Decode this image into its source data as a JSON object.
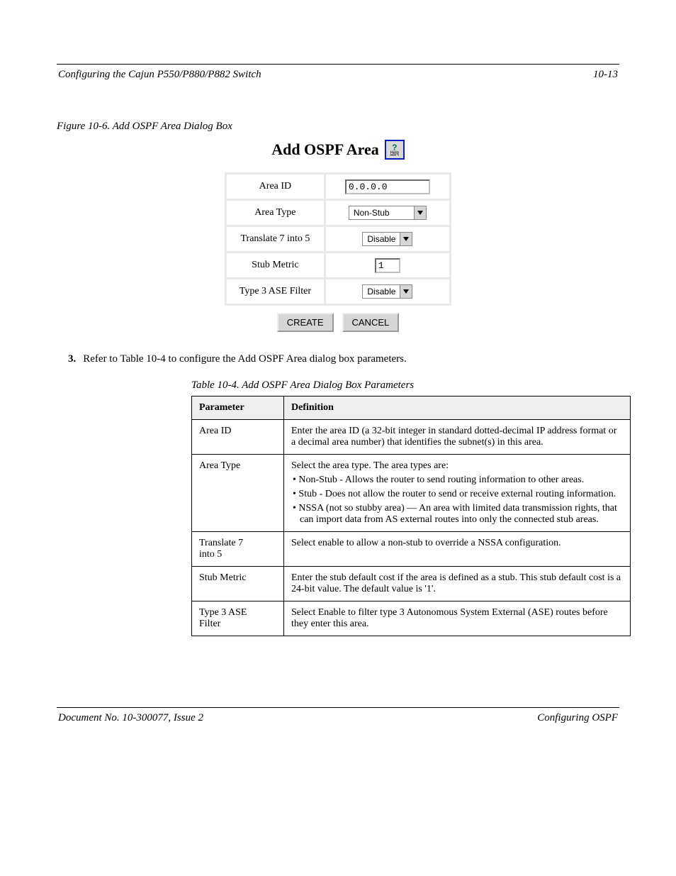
{
  "header": {
    "left": "Configuring the Cajun P550/P880/P882 Switch",
    "right": "10-13"
  },
  "figure": {
    "caption": "Figure 10-6.  Add OSPF Area Dialog Box"
  },
  "dialog": {
    "title": "Add OSPF Area",
    "help_label": "Help",
    "fields": {
      "area_id": {
        "label": "Area ID",
        "value": "0.0.0.0"
      },
      "area_type": {
        "label": "Area Type",
        "value": "Non-Stub"
      },
      "translate": {
        "label": "Translate 7 into 5",
        "value": "Disable"
      },
      "stub_metric": {
        "label": "Stub Metric",
        "value": "1"
      },
      "type3_ase": {
        "label": "Type 3 ASE Filter",
        "value": "Disable"
      }
    },
    "buttons": {
      "create": "CREATE",
      "cancel": "CANCEL"
    }
  },
  "step": {
    "num": "3.",
    "text": "Refer to Table 10-4 to configure the Add OSPF Area dialog box parameters."
  },
  "table": {
    "caption": "Table 10-4.  Add OSPF Area Dialog Box Parameters",
    "headers": {
      "c1": "Parameter",
      "c2": "Definition"
    },
    "rows": [
      {
        "c1": "Area ID",
        "c2": "Enter the area ID (a 32-bit integer in standard dotted-decimal IP address format or a decimal area number) that identifies the subnet(s) in this area."
      },
      {
        "c1": "Area Type",
        "c2": "Select the area type. The area types are:\n• Non-Stub - Allows the router to send routing information to other areas.\n• Stub - Does not allow the router to send or receive external routing information.\n• NSSA (not so stubby area) — An area with limited data transmission rights, that can import data from AS external routes into only the connected stub areas."
      },
      {
        "c1": "Translate 7\ninto 5",
        "c2": "Select enable to allow a non-stub to override a NSSA configuration."
      },
      {
        "c1": "Stub Metric",
        "c2": "Enter the stub default cost if the area is defined as a stub. This stub default cost is a 24-bit value. The default value is '1'."
      },
      {
        "c1": "Type 3 ASE\nFilter",
        "c2": "Select Enable to filter type 3 Autonomous System External (ASE) routes before they enter this area."
      }
    ]
  },
  "footer": {
    "left": "Document No. 10-300077, Issue 2",
    "right": "Configuring OSPF"
  }
}
